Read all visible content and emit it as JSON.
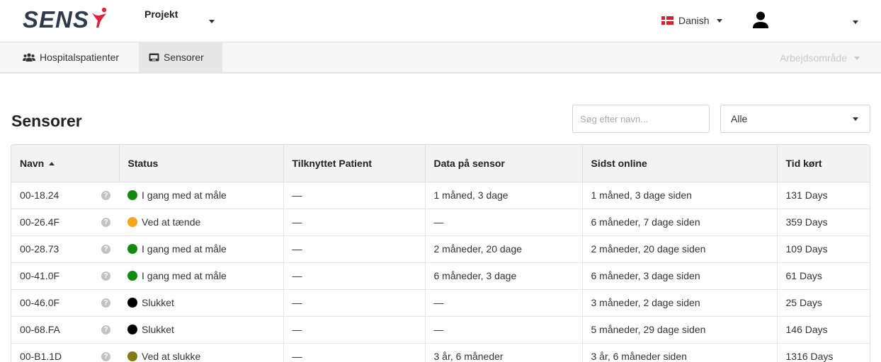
{
  "header": {
    "logo_text": "SENS",
    "project_label": "Projekt",
    "language_label": "Danish",
    "user_name": ""
  },
  "nav": {
    "items": [
      {
        "label": "Hospitalspatienter",
        "icon": "users-icon",
        "active": false
      },
      {
        "label": "Sensorer",
        "icon": "sensor-icon",
        "active": true
      }
    ],
    "workspace_label": "Arbejdsområde"
  },
  "page": {
    "title": "Sensorer",
    "search_placeholder": "Søg efter navn...",
    "filter_value": "Alle"
  },
  "colors": {
    "brand_dark": "#2f3b4c",
    "brand_red": "#e0243b",
    "status_measuring": "#128a12",
    "status_starting": "#f7a51c",
    "status_off": "#000000",
    "status_stopping": "#847a12"
  },
  "table": {
    "columns": [
      "Navn",
      "Status",
      "Tilknyttet Patient",
      "Data på sensor",
      "Sidst online",
      "Tid kørt"
    ],
    "rows": [
      {
        "name": "00-18.24",
        "status": "I gang med at måle",
        "status_color": "#128a12",
        "patient": "—",
        "data": "1 måned, 3 dage",
        "last_online": "1 måned, 3 dage siden",
        "runtime": "131 Days"
      },
      {
        "name": "00-26.4F",
        "status": "Ved at tænde",
        "status_color": "#f7a51c",
        "patient": "—",
        "data": "—",
        "last_online": "6 måneder, 7 dage siden",
        "runtime": "359 Days"
      },
      {
        "name": "00-28.73",
        "status": "I gang med at måle",
        "status_color": "#128a12",
        "patient": "—",
        "data": "2 måneder, 20 dage",
        "last_online": "2 måneder, 20 dage siden",
        "runtime": "109 Days"
      },
      {
        "name": "00-41.0F",
        "status": "I gang med at måle",
        "status_color": "#128a12",
        "patient": "—",
        "data": "6 måneder, 3 dage",
        "last_online": "6 måneder, 3 dage siden",
        "runtime": "61 Days"
      },
      {
        "name": "00-46.0F",
        "status": "Slukket",
        "status_color": "#000000",
        "patient": "—",
        "data": "—",
        "last_online": "3 måneder, 2 dage siden",
        "runtime": "25 Days"
      },
      {
        "name": "00-68.FA",
        "status": "Slukket",
        "status_color": "#000000",
        "patient": "—",
        "data": "—",
        "last_online": "5 måneder, 29 dage siden",
        "runtime": "146 Days"
      },
      {
        "name": "00-B1.1D",
        "status": "Ved at slukke",
        "status_color": "#847a12",
        "patient": "—",
        "data": "3 år, 6 måneder",
        "last_online": "3 år, 6 måneder siden",
        "runtime": "1316 Days"
      }
    ]
  }
}
